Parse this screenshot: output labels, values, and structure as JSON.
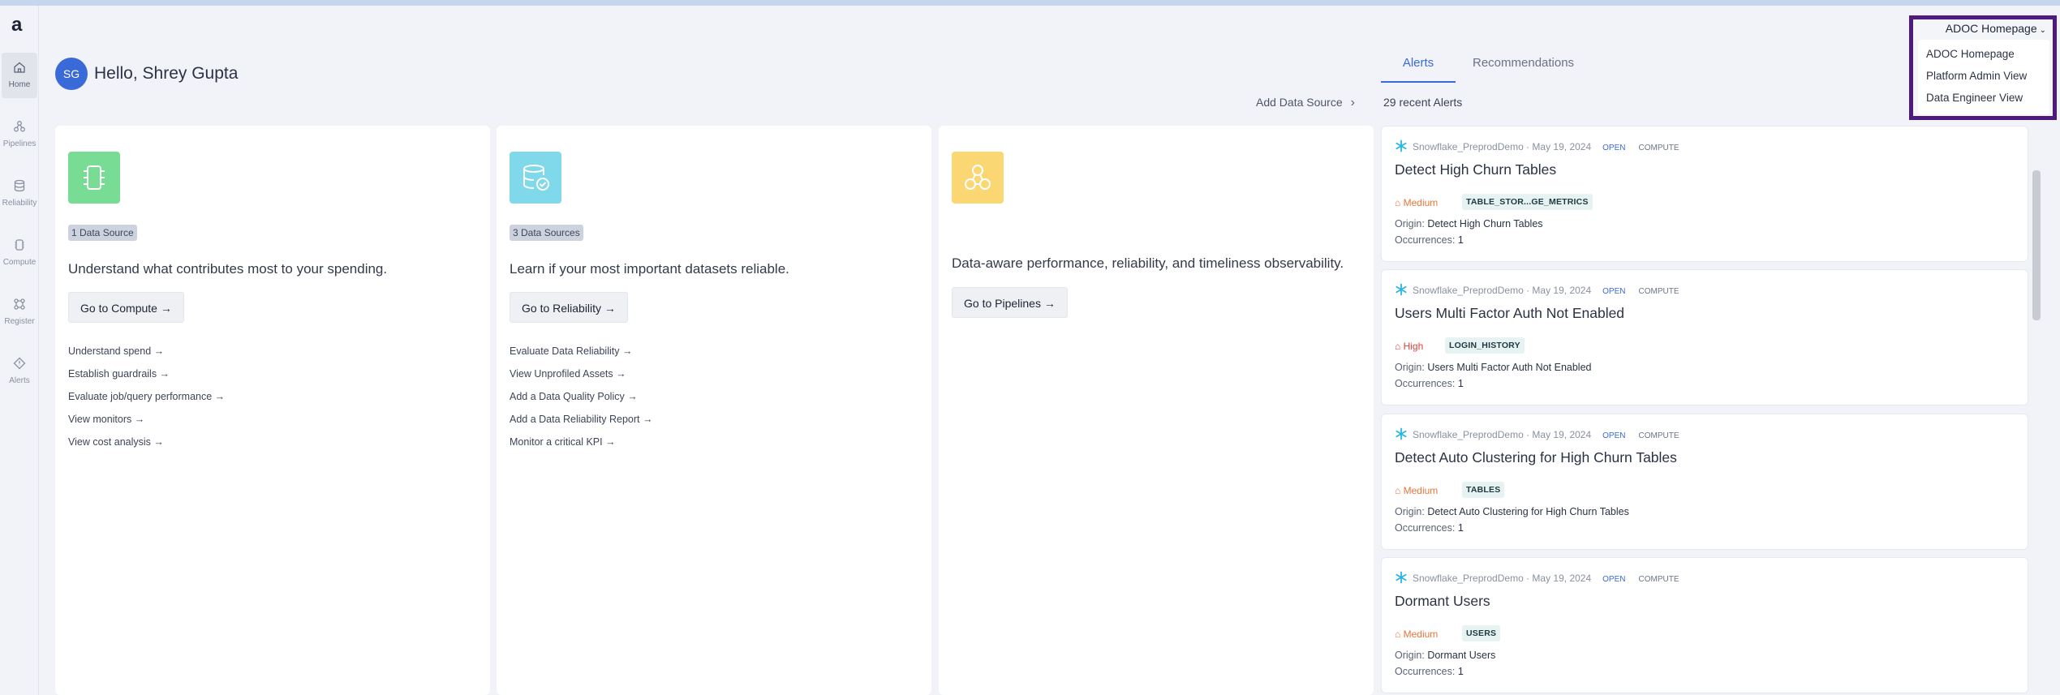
{
  "brand": {
    "logo": "a"
  },
  "sidebar": {
    "items": [
      {
        "label": "Home",
        "icon": "home-icon"
      },
      {
        "label": "Pipelines",
        "icon": "pipelines-icon"
      },
      {
        "label": "Reliability",
        "icon": "database-icon"
      },
      {
        "label": "Compute",
        "icon": "chip-icon"
      },
      {
        "label": "Register",
        "icon": "grid-icon"
      },
      {
        "label": "Alerts",
        "icon": "alert-icon"
      }
    ]
  },
  "header": {
    "avatar_initials": "SG",
    "greeting": "Hello, Shrey Gupta",
    "add_data_source": "Add Data Source"
  },
  "cards": [
    {
      "badge": "1 Data Source",
      "description": "Understand what contributes most to your spending.",
      "button": "Go to Compute →",
      "links": [
        "Understand spend →",
        "Establish guardrails →",
        "Evaluate job/query performance →",
        "View monitors →",
        "View cost analysis →"
      ],
      "icon": "chip-icon",
      "color": "#79dc94"
    },
    {
      "badge": "3 Data Sources",
      "description": "Learn if your most important datasets reliable.",
      "button": "Go to Reliability →",
      "links": [
        "Evaluate Data Reliability →",
        "View Unprofiled Assets →",
        "Add a Data Quality Policy →",
        "Add a Data Reliability Report →",
        "Monitor a critical KPI →"
      ],
      "icon": "database-check-icon",
      "color": "#7fd9eb"
    },
    {
      "description": "Data-aware performance, reliability, and timeliness observability.",
      "button": "Go to Pipelines →",
      "icon": "pipelines-icon",
      "color": "#fbd774"
    }
  ],
  "right_panel": {
    "tabs": [
      "Alerts",
      "Recommendations"
    ],
    "recent_alerts": "29 recent Alerts",
    "origin_label": "Origin:",
    "occurrences_label": "Occurrences:",
    "alerts": [
      {
        "source": "Snowflake_PreprodDemo",
        "date": "May 19, 2024",
        "status": "OPEN",
        "category": "COMPUTE",
        "title": "Detect High Churn Tables",
        "severity": "Medium",
        "table": "TABLE_STOR...GE_METRICS",
        "origin": "Detect High Churn Tables",
        "occurrences": "1"
      },
      {
        "source": "Snowflake_PreprodDemo",
        "date": "May 19, 2024",
        "status": "OPEN",
        "category": "COMPUTE",
        "title": "Users Multi Factor Auth Not Enabled",
        "severity": "High",
        "table": "LOGIN_HISTORY",
        "origin": "Users Multi Factor Auth Not Enabled",
        "occurrences": "1"
      },
      {
        "source": "Snowflake_PreprodDemo",
        "date": "May 19, 2024",
        "status": "OPEN",
        "category": "COMPUTE",
        "title": "Detect Auto Clustering for High Churn Tables",
        "severity": "Medium",
        "table": "TABLES",
        "origin": "Detect Auto Clustering for High Churn Tables",
        "occurrences": "1"
      },
      {
        "source": "Snowflake_PreprodDemo",
        "date": "May 19, 2024",
        "status": "OPEN",
        "category": "COMPUTE",
        "title": "Dormant Users",
        "severity": "Medium",
        "table": "USERS",
        "origin": "Dormant Users",
        "occurrences": "1"
      }
    ]
  },
  "view_switcher": {
    "current": "ADOC Homepage",
    "options": [
      "ADOC Homepage",
      "Platform Admin View",
      "Data Engineer View"
    ]
  },
  "colors": {
    "accent": "#3a6ad8",
    "highlight_border": "#4f1a80",
    "severity_medium": "#e5763b",
    "severity_high": "#d9433c"
  }
}
